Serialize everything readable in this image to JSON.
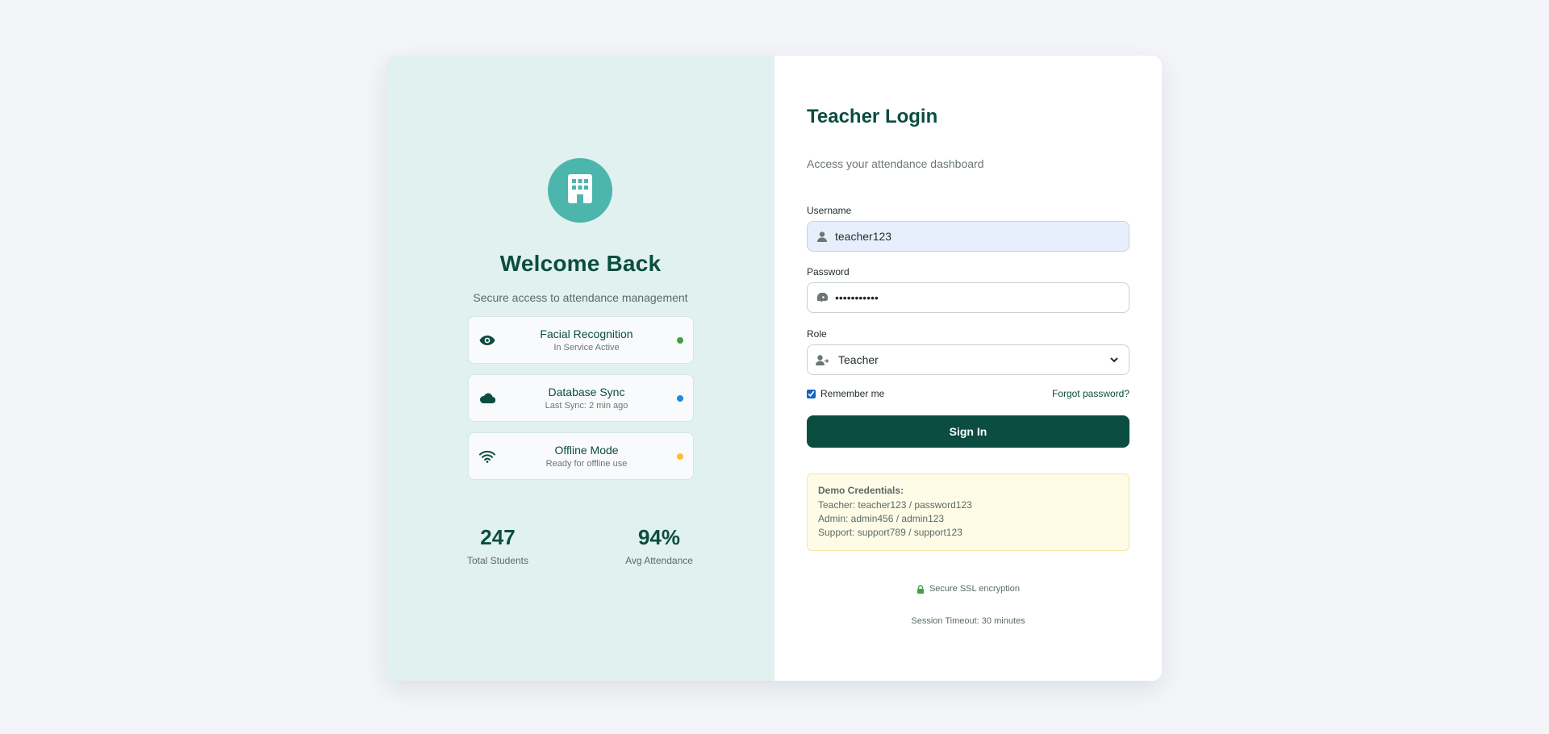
{
  "left": {
    "title": "Welcome Back",
    "subtitle": "Secure access to attendance management",
    "features": [
      {
        "title": "Facial Recognition",
        "status": "In Service Active",
        "icon": "eye-icon",
        "dot_color": "#43a047"
      },
      {
        "title": "Database Sync",
        "status": "Last Sync: 2 min ago",
        "icon": "cloud-icon",
        "dot_color": "#1e88e5"
      },
      {
        "title": "Offline Mode",
        "status": "Ready for offline use",
        "icon": "wifi-icon",
        "dot_color": "#fbc02d"
      }
    ],
    "stats": [
      {
        "value": "247",
        "label": "Total Students"
      },
      {
        "value": "94%",
        "label": "Avg Attendance"
      }
    ]
  },
  "login": {
    "title": "Teacher Login",
    "subtitle": "Access your attendance dashboard",
    "username_label": "Username",
    "username_value": "teacher123",
    "password_label": "Password",
    "password_value": "•••••••••••",
    "role_label": "Role",
    "role_value": "Teacher",
    "remember_label": "Remember me",
    "remember_checked": true,
    "forgot_label": "Forgot password?",
    "signin_label": "Sign In"
  },
  "demo": {
    "heading": "Demo Credentials:",
    "lines": [
      "Teacher: teacher123 / password123",
      "Admin: admin456 / admin123",
      "Support: support789 / support123"
    ]
  },
  "footer": {
    "secure_text": "Secure SSL encryption",
    "timeout_text": "Session Timeout: 30 minutes"
  },
  "colors": {
    "brand_dark": "#0b4d40",
    "brand_teal": "#4db6ac",
    "panel_bg": "#e0f1ef"
  }
}
